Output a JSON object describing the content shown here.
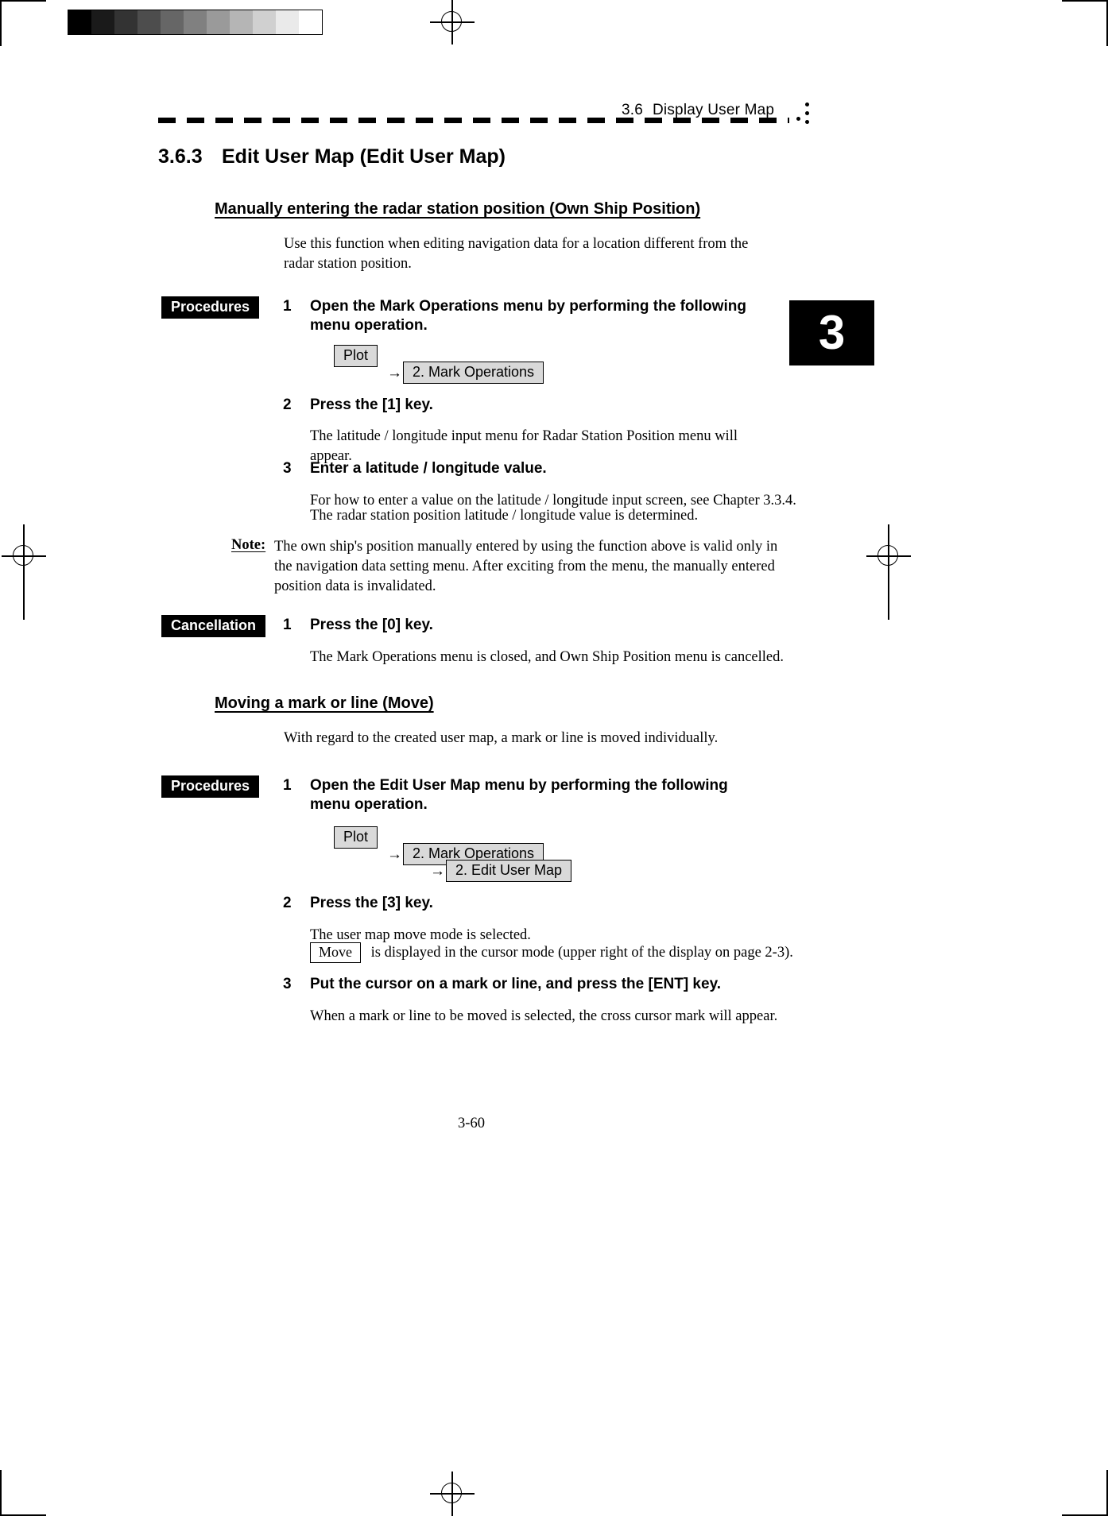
{
  "document": {
    "running_header": {
      "number": "3.6",
      "title": "Display User Map"
    },
    "chapter_tab": "3",
    "page_number": "3-60"
  },
  "section": {
    "number": "3.6.3",
    "title": "Edit User Map (Edit User Map)"
  },
  "subsection_a": {
    "heading": "Manually entering the radar station position (Own Ship Position)",
    "intro": "Use this function when editing navigation data for a location different from the radar station position.",
    "procedures_tag": "Procedures",
    "steps": [
      {
        "number": "1",
        "title": "Open the Mark Operations menu by performing the following menu operation.",
        "menu_path": [
          "Plot",
          "2. Mark Operations"
        ]
      },
      {
        "number": "2",
        "title": "Press the [1] key.",
        "detail": "The latitude / longitude input menu for Radar Station Position menu will appear."
      },
      {
        "number": "3",
        "title": "Enter a latitude / longitude value.",
        "detail_line_1": "For how to enter a value on the latitude / longitude input screen, see Chapter 3.3.4.",
        "detail_line_2": "The radar station position latitude / longitude value is determined."
      }
    ],
    "note": {
      "label": "Note:",
      "text": "The own ship's position manually entered by using the function above is valid only in the navigation data setting menu.    After exciting from the menu, the manually entered position data is invalidated."
    },
    "cancellation_tag": "Cancellation",
    "cancellation_steps": [
      {
        "number": "1",
        "title": "Press the [0] key.",
        "detail": "The Mark Operations menu is closed, and Own Ship Position menu is cancelled."
      }
    ]
  },
  "subsection_b": {
    "heading": "Moving a mark or line (Move)",
    "intro": "With regard to the created user map, a mark or line is moved individually.",
    "procedures_tag": "Procedures",
    "steps": [
      {
        "number": "1",
        "title": "Open the Edit User Map menu by performing the following menu operation.",
        "menu_path": [
          "Plot",
          "2. Mark Operations",
          "2. Edit User Map"
        ]
      },
      {
        "number": "2",
        "title": "Press the [3] key.",
        "detail_line_1": "The user map move mode is selected.",
        "detail_box": "Move",
        "detail_line_2": "is displayed in the cursor mode (upper right of the display on page 2-3)."
      },
      {
        "number": "3",
        "title": "Put the cursor on a mark or line, and press the [ENT] key.",
        "detail": "When a mark or line to be moved is selected, the cross cursor mark will appear."
      }
    ]
  },
  "arrow_glyph": "→",
  "calibration_strip": {
    "swatches": [
      "#000000",
      "#1a1a1a",
      "#333333",
      "#4d4d4d",
      "#666666",
      "#808080",
      "#9a9a9a",
      "#b5b5b5",
      "#d0d0d0",
      "#eaeaea",
      "#ffffff"
    ]
  }
}
